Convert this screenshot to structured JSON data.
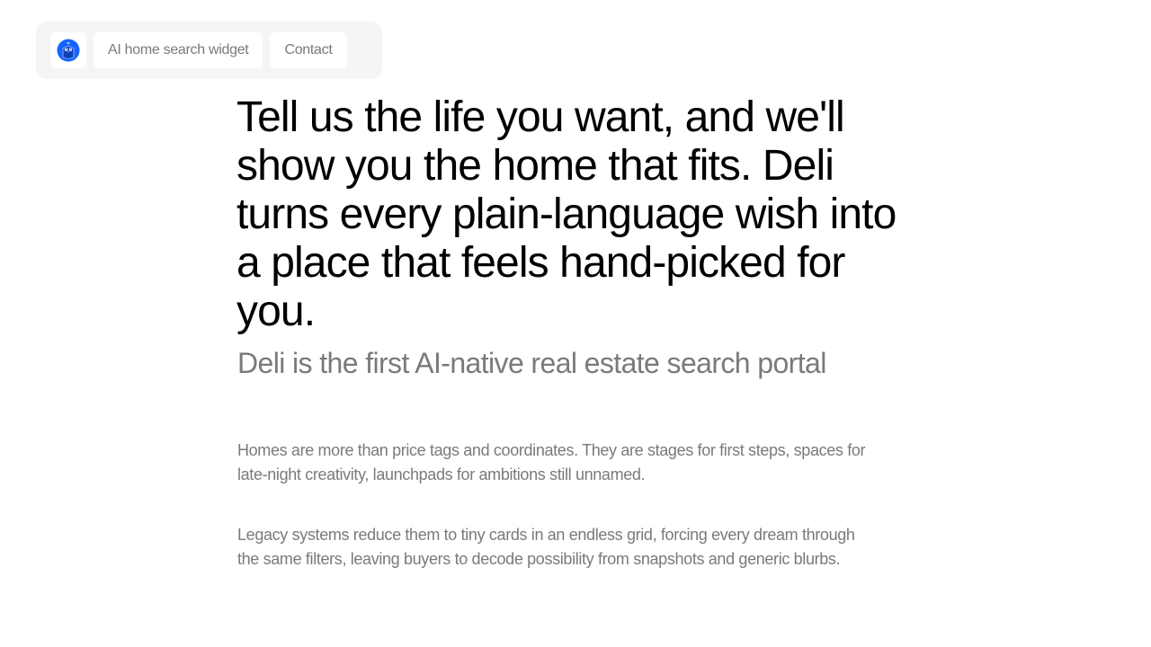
{
  "nav": {
    "logo_icon": "deli-owl-logo-icon",
    "brand_color": "#1463ff",
    "links": [
      {
        "label": "AI home search widget"
      },
      {
        "label": "Contact"
      }
    ]
  },
  "hero": {
    "headline": "Tell us the life you want, and we'll show you the home that fits. Deli turns every plain-language wish into a place that feels hand-picked for you.",
    "subtitle": "Deli is the first AI-native real estate search portal"
  },
  "body": {
    "paragraphs": [
      "Homes are more than price tags and coordinates. They are stages for first steps, spaces for late-night creativity, launchpads for ambitions still unnamed.",
      "Legacy systems reduce them to tiny cards in an endless grid, forcing every dream through the same filters, leaving buyers to decode possibility from snapshots and generic blurbs."
    ]
  }
}
